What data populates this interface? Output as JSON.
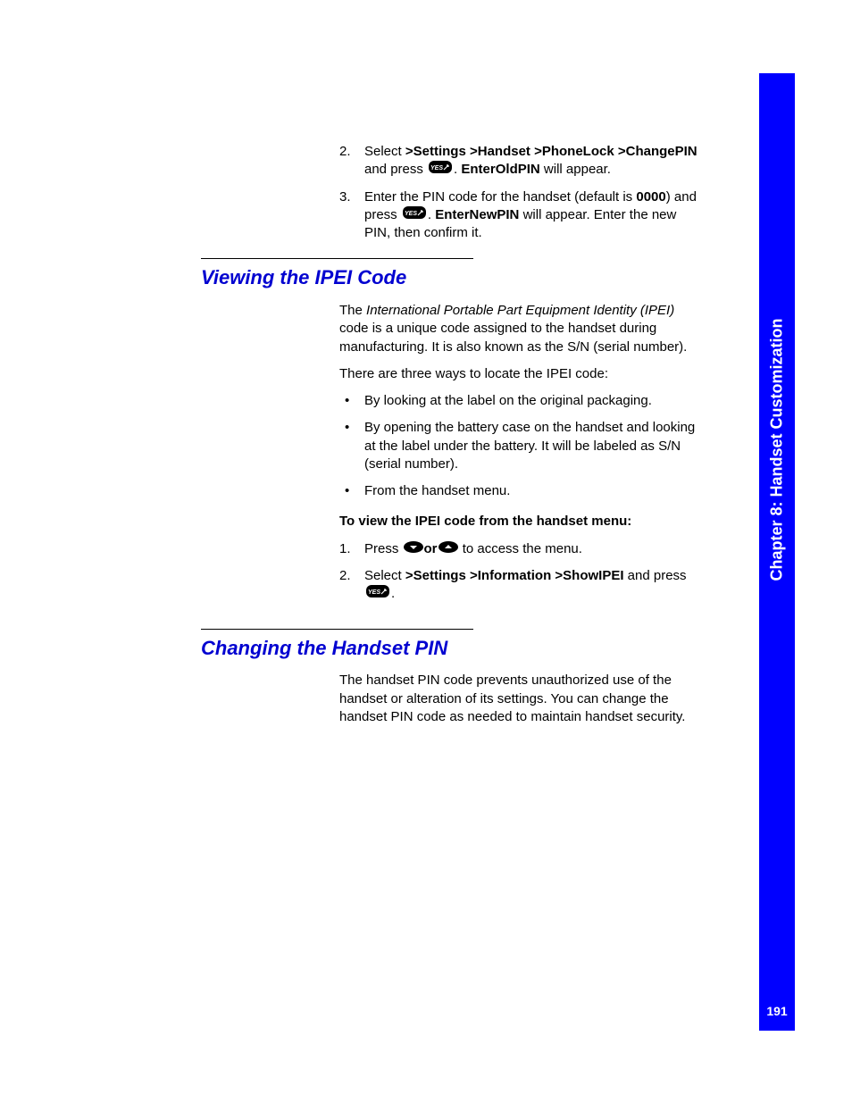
{
  "sidebar": {
    "chapter_label": "Chapter 8: Handset Customization",
    "page_number": "191"
  },
  "top_steps": {
    "step2": {
      "num": "2.",
      "t1": "Select",
      "t2": ">Settings >Handset >PhoneLock >ChangePIN",
      "t3": "and press",
      "t4": ".",
      "t5": "EnterOldPIN",
      "t6": "will appear."
    },
    "step3": {
      "num": "3.",
      "t1": "Enter the PIN code for the handset (default is",
      "t2": "0000",
      "t3": ") and press",
      "t4": ".",
      "t5": "EnterNewPIN",
      "t6": "will appear. Enter the new PIN, then confirm it."
    }
  },
  "section1": {
    "heading": "Viewing the IPEI Code",
    "p1a": "The",
    "p1b": "International Portable Part Equipment Identity (IPEI)",
    "p1c": "code is a unique code assigned to the handset during manufacturing. It is also known as the S/N (serial number).",
    "p2": "There are three ways to locate the IPEI code:",
    "bul1": "By looking at the label on the original packaging.",
    "bul2": "By opening the battery case on the handset and looking at the label under the battery. It will be labeled as S/N (serial number).",
    "bul3": "From the handset menu.",
    "sub": "To view the IPEI code from the handset menu:",
    "s1_num": "1.",
    "s1a": "Press",
    "s1b": "or",
    "s1c": "to access the menu.",
    "s2_num": "2.",
    "s2a": "Select",
    "s2b": ">Settings >Information >ShowIPEI",
    "s2c": "and press",
    "s2d": "."
  },
  "section2": {
    "heading": "Changing the Handset PIN",
    "p1": "The handset PIN code prevents unauthorized use of the handset or alteration of its settings. You can change the handset PIN code as needed to maintain handset security."
  }
}
